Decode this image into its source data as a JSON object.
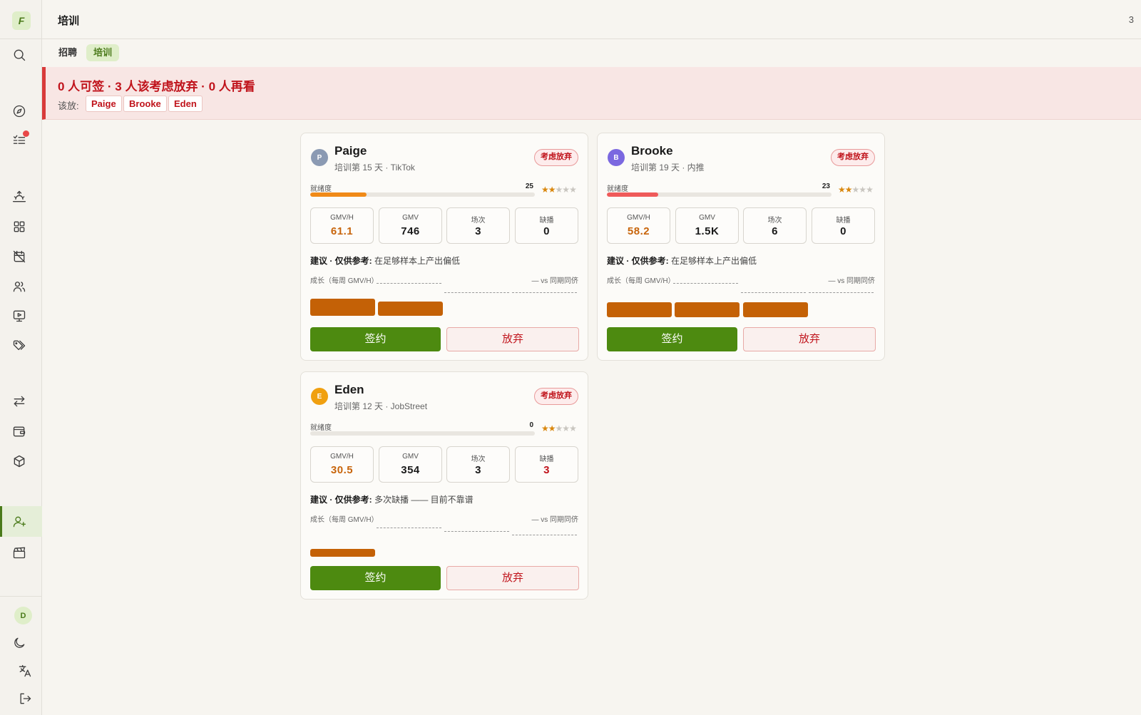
{
  "app": {
    "logo": "F",
    "title": "培训",
    "top_count": "3"
  },
  "tabs": [
    {
      "label": "招聘",
      "active": false
    },
    {
      "label": "培训",
      "active": true
    }
  ],
  "alert": {
    "title": "0 人可签 · 3 人该考虑放弃 · 0 人再看",
    "label": "该放:",
    "chips": [
      "Paige",
      "Brooke",
      "Eden"
    ]
  },
  "user_avatar": "D",
  "cards": [
    {
      "initial": "P",
      "avatar_color": "#8b9ab3",
      "name": "Paige",
      "subtitle": "培训第 15 天 · TikTok",
      "badge": "考虑放弃",
      "ready_label": "就绪度",
      "ready_value": "25",
      "ready_pct": 25,
      "ready_color": "#f08a18",
      "stars": 2,
      "stats": [
        {
          "label": "GMV/H",
          "value": "61.1",
          "tone": "orange"
        },
        {
          "label": "GMV",
          "value": "746",
          "tone": ""
        },
        {
          "label": "场次",
          "value": "3",
          "tone": ""
        },
        {
          "label": "缺播",
          "value": "0",
          "tone": ""
        }
      ],
      "advice_prefix": "建议 · 仅供参考:",
      "advice_text": " 在足够样本上产出偏低",
      "growth_label": "成长（每周 GMV/H）",
      "vs_label": "— vs 同期同侪",
      "bars": 2,
      "sign_label": "签约",
      "drop_label": "放弃"
    },
    {
      "initial": "B",
      "avatar_color": "#7b68e0",
      "name": "Brooke",
      "subtitle": "培训第 19 天 · 内推",
      "badge": "考虑放弃",
      "ready_label": "就绪度",
      "ready_value": "23",
      "ready_pct": 23,
      "ready_color": "#ef5a5a",
      "stars": 2,
      "stats": [
        {
          "label": "GMV/H",
          "value": "58.2",
          "tone": "orange"
        },
        {
          "label": "GMV",
          "value": "1.5K",
          "tone": ""
        },
        {
          "label": "场次",
          "value": "6",
          "tone": ""
        },
        {
          "label": "缺播",
          "value": "0",
          "tone": ""
        }
      ],
      "advice_prefix": "建议 · 仅供参考:",
      "advice_text": " 在足够样本上产出偏低",
      "growth_label": "成长（每周 GMV/H）",
      "vs_label": "— vs 同期同侪",
      "bars": 3,
      "sign_label": "签约",
      "drop_label": "放弃"
    },
    {
      "initial": "E",
      "avatar_color": "#f0a010",
      "name": "Eden",
      "subtitle": "培训第 12 天 · JobStreet",
      "badge": "考虑放弃",
      "ready_label": "就绪度",
      "ready_value": "0",
      "ready_pct": 0,
      "ready_color": "#f08a18",
      "stars": 2,
      "stats": [
        {
          "label": "GMV/H",
          "value": "30.5",
          "tone": "orange"
        },
        {
          "label": "GMV",
          "value": "354",
          "tone": ""
        },
        {
          "label": "场次",
          "value": "3",
          "tone": ""
        },
        {
          "label": "缺播",
          "value": "3",
          "tone": "red"
        }
      ],
      "advice_prefix": "建议 · 仅供参考:",
      "advice_text": " 多次缺播 —— 目前不靠谱",
      "growth_label": "成长（每周 GMV/H）",
      "vs_label": "— vs 同期同侪",
      "bars": 1,
      "sign_label": "签约",
      "drop_label": "放弃"
    }
  ]
}
